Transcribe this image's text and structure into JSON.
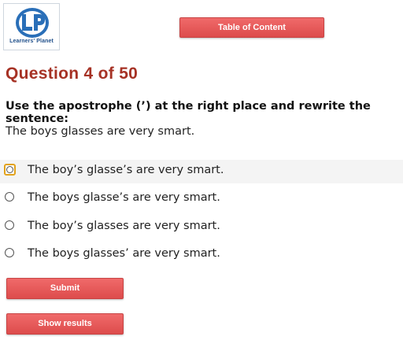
{
  "logo": {
    "text": "Learners' Planet",
    "mark": "LP"
  },
  "toolbar": {
    "toc_label": "Table of Content"
  },
  "question": {
    "title": "Question 4 of 50",
    "instruction": "Use the apostrophe (’) at the right place and rewrite the sentence:",
    "sentence": "The boys glasses are very smart."
  },
  "options": [
    {
      "label": "The boy’s glasse’s are very smart.",
      "focused": true
    },
    {
      "label": "The boys glasse’s are very smart.",
      "focused": false
    },
    {
      "label": "The boy’s glasses are very smart.",
      "focused": false
    },
    {
      "label": "The boys glasses’ are very smart.",
      "focused": false
    }
  ],
  "actions": {
    "submit_label": "Submit",
    "results_label": "Show results"
  },
  "colors": {
    "button": "#e85a5a",
    "title": "#a63225",
    "focus": "#e2a21b",
    "logo": "#1f4f8a"
  }
}
